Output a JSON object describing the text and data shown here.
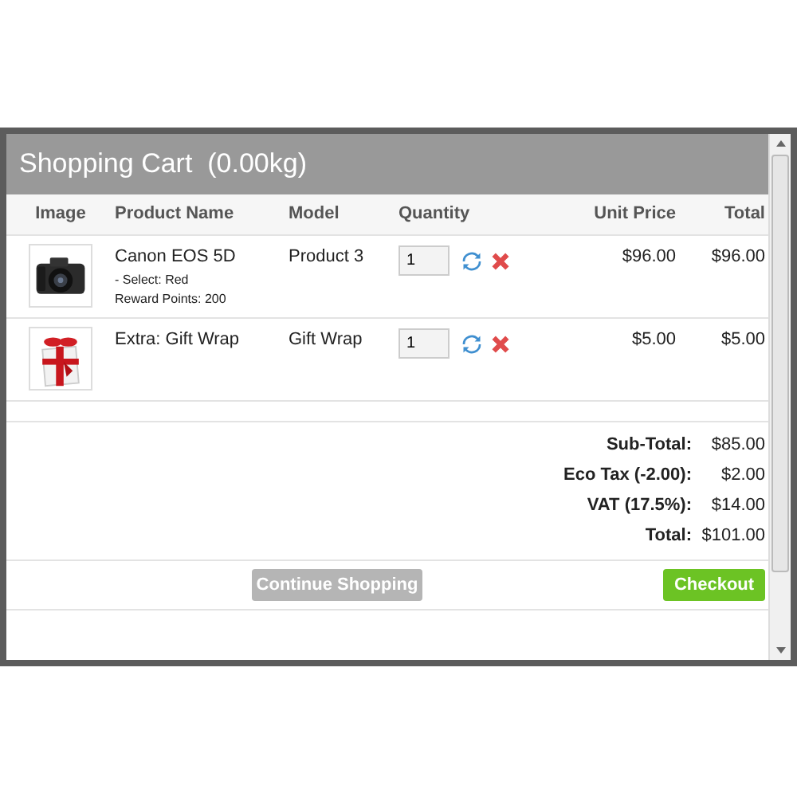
{
  "title": "Shopping Cart  (0.00kg)",
  "columns": [
    "Image",
    "Product Name",
    "Model",
    "Quantity",
    "Unit Price",
    "Total"
  ],
  "rows": [
    {
      "kind": "camera",
      "name": "Canon EOS 5D",
      "options": [
        "- Select: Red",
        "Reward Points: 200"
      ],
      "model": "Product 3",
      "quantity": "1",
      "unit_price": "$96.00",
      "total": "$96.00"
    },
    {
      "kind": "gift",
      "name": "Extra: Gift Wrap",
      "options": [],
      "model": "Gift Wrap",
      "quantity": "1",
      "unit_price": "$5.00",
      "total": "$5.00"
    }
  ],
  "totals": [
    {
      "label": "Sub-Total:",
      "value": "$85.00"
    },
    {
      "label": "Eco Tax (-2.00):",
      "value": "$2.00"
    },
    {
      "label": "VAT (17.5%):",
      "value": "$14.00"
    },
    {
      "label": "Total:",
      "value": "$101.00"
    }
  ],
  "buttons": {
    "continue": "Continue Shopping",
    "checkout": "Checkout"
  }
}
